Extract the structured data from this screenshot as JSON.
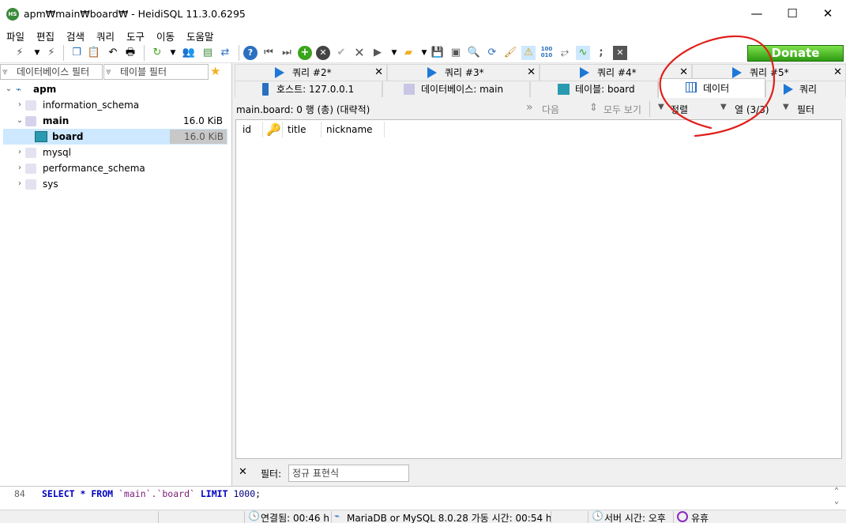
{
  "window": {
    "title": "apm₩main₩board₩ - HeidiSQL 11.3.0.6295",
    "app_icon": "HS",
    "minimize": "—",
    "maximize": "☐",
    "close": "✕"
  },
  "menu": [
    "파일",
    "편집",
    "검색",
    "쿼리",
    "도구",
    "이동",
    "도움말"
  ],
  "donate_label": "Donate",
  "left": {
    "db_filter_placeholder": "데이터베이스 필터",
    "table_filter_placeholder": "테이블 필터",
    "tree": [
      {
        "label": "apm",
        "size": "",
        "level": 0
      },
      {
        "label": "information_schema",
        "size": "",
        "level": 1
      },
      {
        "label": "main",
        "size": "16.0 KiB",
        "level": 1
      },
      {
        "label": "board",
        "size": "16.0 KiB",
        "level": 2
      },
      {
        "label": "mysql",
        "size": "",
        "level": 1
      },
      {
        "label": "performance_schema",
        "size": "",
        "level": 1
      },
      {
        "label": "sys",
        "size": "",
        "level": 1
      }
    ]
  },
  "tabs_row1": [
    {
      "label": "쿼리 #2*"
    },
    {
      "label": "쿼리 #3*"
    },
    {
      "label": "쿼리 #4*"
    },
    {
      "label": "쿼리 #5*"
    }
  ],
  "tabs_row2": [
    {
      "label": "호스트: 127.0.0.1"
    },
    {
      "label": "데이터베이스: main"
    },
    {
      "label": "테이블: board"
    },
    {
      "label": "데이터"
    },
    {
      "label": "쿼리"
    }
  ],
  "data": {
    "summary": "main.board: 0 행 (총) (대략적)",
    "next": "다음",
    "show_all": "모두 보기",
    "sort": "정렬",
    "columns": "열 (3/3)",
    "filter": "필터",
    "headers": [
      "id",
      "title",
      "nickname"
    ]
  },
  "filterbar": {
    "close": "✕",
    "label": "필터:",
    "placeholder": "정규 표현식"
  },
  "sqllog": {
    "line_no": "84",
    "sql_select": "SELECT",
    "sql_star": "*",
    "sql_from": "FROM",
    "sql_table": "`main`.`board`",
    "sql_limit": "LIMIT",
    "sql_count": "1000",
    "sql_end": ";"
  },
  "status": {
    "connected": "연결됨: 00:46 h",
    "server": "MariaDB or MySQL 8.0.28 가동 시간: 00:54 h",
    "server_time": "서버 시간: 오후",
    "idle": "유휴"
  },
  "colors": {
    "annotation": "#e0201a",
    "play_icon": "#1e78d6",
    "donate_green": "#3aa51a"
  }
}
